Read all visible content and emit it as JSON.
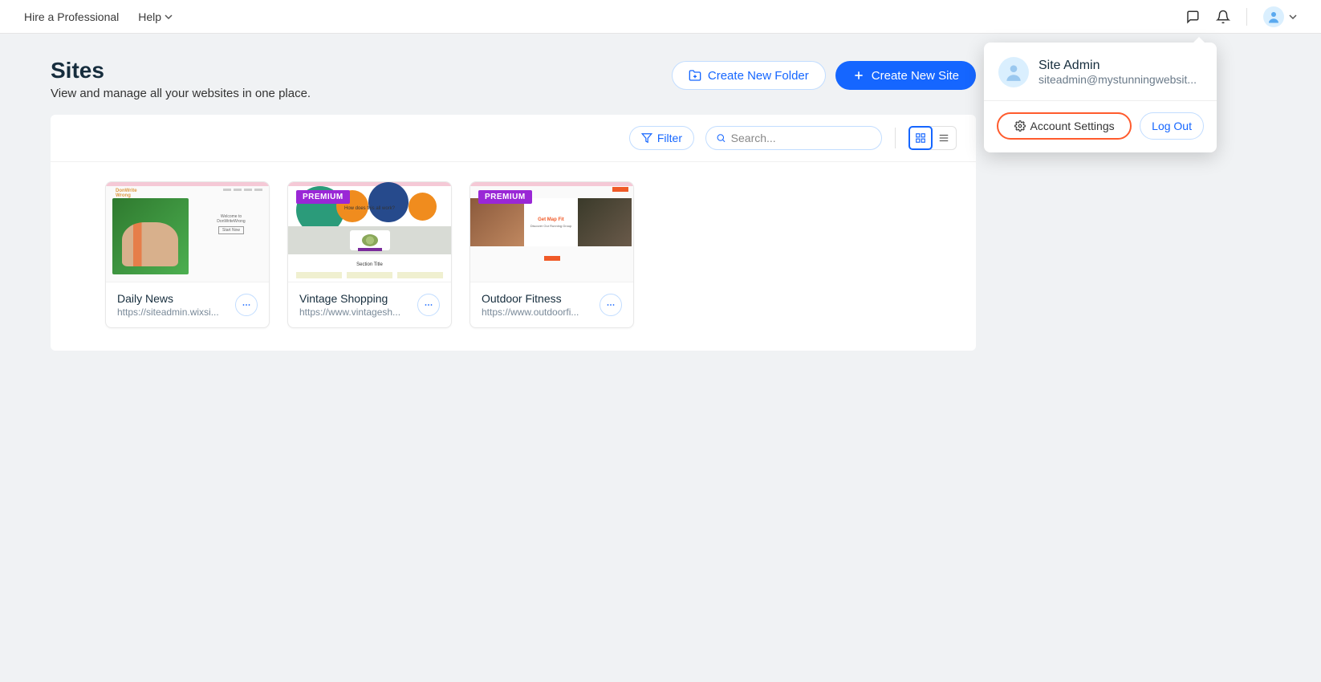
{
  "topbar": {
    "hire_link": "Hire a Professional",
    "help_link": "Help"
  },
  "page": {
    "title": "Sites",
    "subtitle": "View and manage all your websites in one place.",
    "create_folder_label": "Create New Folder",
    "create_site_label": "Create New Site"
  },
  "toolbar": {
    "filter_label": "Filter",
    "search_placeholder": "Search..."
  },
  "badges": {
    "premium": "PREMIUM"
  },
  "sites": [
    {
      "title": "Daily News",
      "url": "https://siteadmin.wixsi...",
      "premium": false
    },
    {
      "title": "Vintage Shopping",
      "url": "https://www.vintagesh...",
      "premium": true
    },
    {
      "title": "Outdoor Fitness",
      "url": "https://www.outdoorfi...",
      "premium": true
    }
  ],
  "thumb_text": {
    "card0_brand": "DonWrite\nWrong",
    "card0_welcome": "Welcome to",
    "card0_brand2": "DonWriteWrong",
    "card0_cta": "Start Now",
    "card1_hero": "How does this all work?",
    "card1_section": "Section Title",
    "card2_title": "Get Map Fit",
    "card2_sub": "Discover Our Running Group"
  },
  "dropdown": {
    "name": "Site Admin",
    "email": "siteadmin@mystunningwebsit...",
    "account_settings": "Account Settings",
    "logout": "Log Out"
  }
}
